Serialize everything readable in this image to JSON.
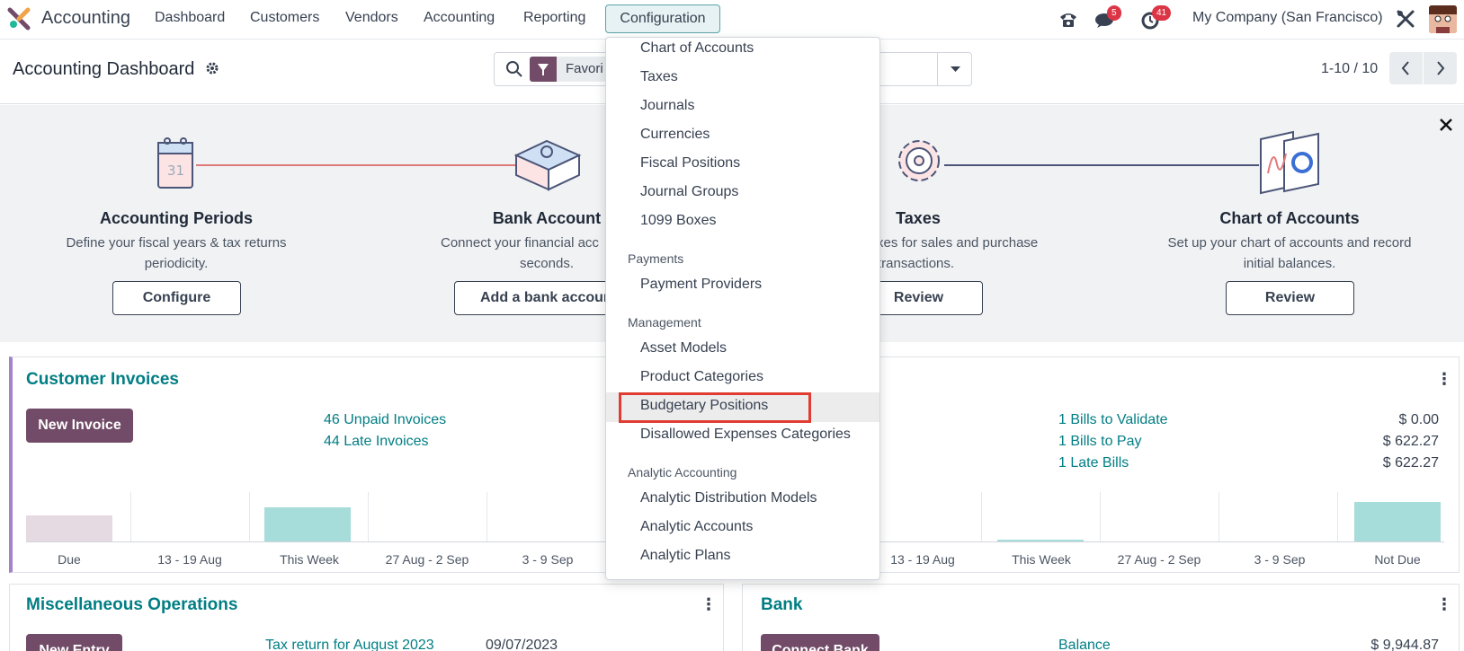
{
  "nav": {
    "app_name": "Accounting",
    "items": [
      "Dashboard",
      "Customers",
      "Vendors",
      "Accounting",
      "Reporting",
      "Configuration"
    ],
    "messages_badge": "5",
    "activities_badge": "41",
    "company": "My Company (San Francisco)"
  },
  "control_panel": {
    "title": "Accounting Dashboard",
    "filter_facet": "Favori",
    "pager": "1-10 / 10"
  },
  "onboarding": {
    "steps": [
      {
        "title": "Accounting Periods",
        "desc1": "Define your fiscal years & tax returns",
        "desc2": "periodicity.",
        "button": "Configure"
      },
      {
        "title": "Bank Account",
        "desc1": "Connect your financial acc",
        "desc2": "seconds.",
        "button": "Add a bank accour"
      },
      {
        "title": "Taxes",
        "desc1": "xes for sales and purchase",
        "desc2": "transactions.",
        "button": "Review"
      },
      {
        "title": "Chart of Accounts",
        "desc1": "Set up your chart of accounts and record",
        "desc2": "initial balances.",
        "button": "Review"
      }
    ],
    "calendar_day": "31"
  },
  "customer_invoices": {
    "title": "Customer Invoices",
    "button": "New Invoice",
    "links": [
      "46 Unpaid Invoices",
      "44 Late Invoices"
    ],
    "graph_labels": [
      "Due",
      "13 - 19 Aug",
      "This Week",
      "27 Aug - 2 Sep",
      "3 - 9 Sep"
    ]
  },
  "vendor_bills": {
    "links": [
      "1 Bills to Validate",
      "1 Bills to Pay",
      "1 Late Bills"
    ],
    "amounts": [
      "$ 0.00",
      "$ 622.27",
      "$ 622.27"
    ],
    "graph_labels": [
      "13 - 19 Aug",
      "This Week",
      "27 Aug - 2 Sep",
      "3 - 9 Sep",
      "Not Due"
    ]
  },
  "misc_operations": {
    "title": "Miscellaneous Operations",
    "button": "New Entry",
    "link": "Tax return for August 2023",
    "date": "09/07/2023"
  },
  "bank": {
    "title": "Bank",
    "button": "Connect Bank",
    "balance_label": "Balance",
    "balance": "$ 9,944.87"
  },
  "dropdown": {
    "group1": [
      "Chart of Accounts",
      "Taxes",
      "Journals",
      "Currencies",
      "Fiscal Positions",
      "Journal Groups",
      "1099 Boxes"
    ],
    "payments_header": "Payments",
    "payments": [
      "Payment Providers"
    ],
    "management_header": "Management",
    "management": [
      "Asset Models",
      "Product Categories",
      "Budgetary Positions",
      "Disallowed Expenses Categories"
    ],
    "analytic_header": "Analytic Accounting",
    "analytic": [
      "Analytic Distribution Models",
      "Analytic Accounts",
      "Analytic Plans"
    ]
  },
  "colors": {
    "brand": "#714b67",
    "link": "#017e84",
    "highlight_border": "#e03c31"
  }
}
